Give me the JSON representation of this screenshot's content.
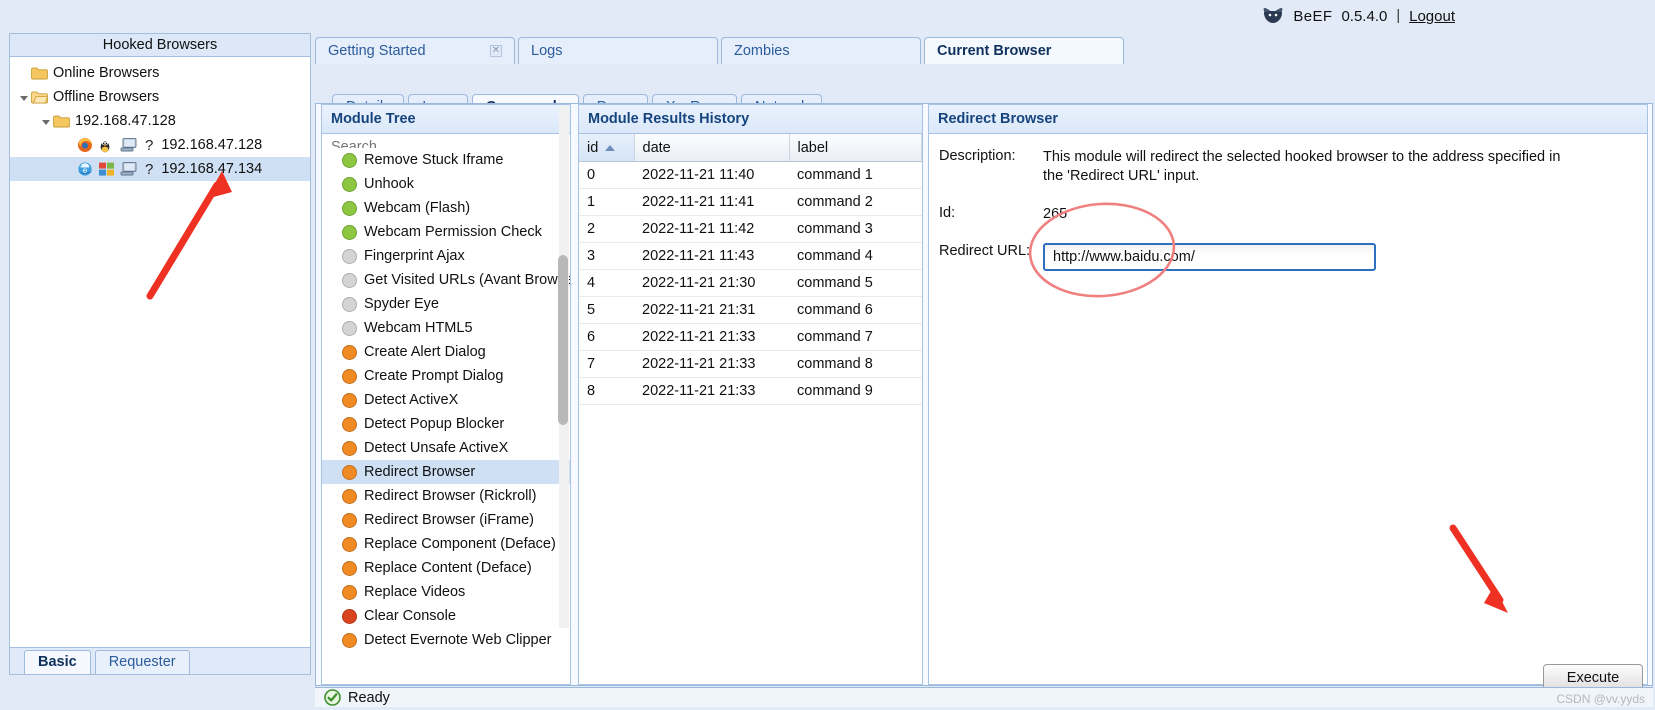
{
  "topbar": {
    "logo_icon": "beef-logo-icon",
    "app_name": "BeEF",
    "version": "0.5.4.0",
    "separator": "|",
    "logout": "Logout"
  },
  "sidebar": {
    "title": "Hooked Browsers",
    "tree": [
      {
        "label": "Online Browsers",
        "level": 1,
        "icon": "folder-icon",
        "expander": "none",
        "selected": false
      },
      {
        "label": "Offline Browsers",
        "level": 1,
        "icon": "folder-open-icon",
        "expander": "open",
        "selected": false
      },
      {
        "label": "192.168.47.128",
        "level": 2,
        "icon": "folder-icon",
        "expander": "open",
        "selected": false
      },
      {
        "label": "192.168.47.128",
        "level": 3,
        "icon": "browser-firefox-icon,os-linux-icon,monitor-icon,question-icon",
        "expander": "none",
        "selected": false
      },
      {
        "label": "192.168.47.134",
        "level": 3,
        "icon": "browser-ie-icon,os-windows-icon,monitor-icon,question-icon",
        "expander": "none",
        "selected": true
      }
    ],
    "tabs": [
      {
        "label": "Basic",
        "active": true
      },
      {
        "label": "Requester",
        "active": false
      }
    ]
  },
  "main_tabs": [
    {
      "label": "Getting Started",
      "active": false,
      "closable": true,
      "close_icon": "close-icon"
    },
    {
      "label": "Logs",
      "active": false,
      "closable": false
    },
    {
      "label": "Zombies",
      "active": false,
      "closable": false
    },
    {
      "label": "Current Browser",
      "active": true,
      "closable": false
    }
  ],
  "sub_tabs": [
    {
      "label": "Details",
      "active": false
    },
    {
      "label": "Logs",
      "active": false
    },
    {
      "label": "Commands",
      "active": true
    },
    {
      "label": "Proxy",
      "active": false
    },
    {
      "label": "XssRays",
      "active": false
    },
    {
      "label": "Network",
      "active": false
    }
  ],
  "module_tree": {
    "title": "Module Tree",
    "search_placeholder": "Search",
    "search_value": "",
    "scroll_position_pct": 42,
    "modules": [
      {
        "label": "Remove Stuck Iframe",
        "status": "green",
        "selected": false,
        "clipped": true
      },
      {
        "label": "Unhook",
        "status": "green",
        "selected": false
      },
      {
        "label": "Webcam (Flash)",
        "status": "green",
        "selected": false
      },
      {
        "label": "Webcam Permission Check",
        "status": "green",
        "selected": false
      },
      {
        "label": "Fingerprint Ajax",
        "status": "gray",
        "selected": false
      },
      {
        "label": "Get Visited URLs (Avant Browser)",
        "status": "gray",
        "selected": false
      },
      {
        "label": "Spyder Eye",
        "status": "gray",
        "selected": false
      },
      {
        "label": "Webcam HTML5",
        "status": "gray",
        "selected": false
      },
      {
        "label": "Create Alert Dialog",
        "status": "orange",
        "selected": false
      },
      {
        "label": "Create Prompt Dialog",
        "status": "orange",
        "selected": false
      },
      {
        "label": "Detect ActiveX",
        "status": "orange",
        "selected": false
      },
      {
        "label": "Detect Popup Blocker",
        "status": "orange",
        "selected": false
      },
      {
        "label": "Detect Unsafe ActiveX",
        "status": "orange",
        "selected": false
      },
      {
        "label": "Redirect Browser",
        "status": "orange",
        "selected": true
      },
      {
        "label": "Redirect Browser (Rickroll)",
        "status": "orange",
        "selected": false
      },
      {
        "label": "Redirect Browser (iFrame)",
        "status": "orange",
        "selected": false
      },
      {
        "label": "Replace Component (Deface)",
        "status": "orange",
        "selected": false
      },
      {
        "label": "Replace Content (Deface)",
        "status": "orange",
        "selected": false
      },
      {
        "label": "Replace Videos",
        "status": "orange",
        "selected": false
      },
      {
        "label": "Clear Console",
        "status": "red",
        "selected": false
      },
      {
        "label": "Detect Evernote Web Clipper",
        "status": "orange",
        "selected": false,
        "clipped": true
      }
    ],
    "status_colors": {
      "green": "#8dc641",
      "gray": "#d4d4d4",
      "orange": "#f08a24",
      "red": "#d9441f"
    }
  },
  "results": {
    "title": "Module Results History",
    "columns": [
      "id",
      "date",
      "label"
    ],
    "sort_column": "id",
    "sort_direction": "asc",
    "rows": [
      {
        "id": "0",
        "date": "2022-11-21 11:40",
        "label": "command 1"
      },
      {
        "id": "1",
        "date": "2022-11-21 11:41",
        "label": "command 2"
      },
      {
        "id": "2",
        "date": "2022-11-21 11:42",
        "label": "command 3"
      },
      {
        "id": "3",
        "date": "2022-11-21 11:43",
        "label": "command 4"
      },
      {
        "id": "4",
        "date": "2022-11-21 21:30",
        "label": "command 5"
      },
      {
        "id": "5",
        "date": "2022-11-21 21:31",
        "label": "command 6"
      },
      {
        "id": "6",
        "date": "2022-11-21 21:33",
        "label": "command 7"
      },
      {
        "id": "7",
        "date": "2022-11-21 21:33",
        "label": "command 8"
      },
      {
        "id": "8",
        "date": "2022-11-21 21:33",
        "label": "command 9"
      }
    ]
  },
  "detail": {
    "title": "Redirect Browser",
    "description_label": "Description:",
    "description_value": "This module will redirect the selected hooked browser to the address specified in the 'Redirect URL' input.",
    "id_label": "Id:",
    "id_value": "265",
    "url_label": "Redirect URL:",
    "url_value": "http://www.baidu.com/",
    "execute_label": "Execute"
  },
  "status_bar": {
    "icon": "check-circle-icon",
    "text": "Ready"
  },
  "watermark": "CSDN @vv.yyds",
  "annotations": {
    "arrow_color": "#ef3124",
    "circle_color": "#f08080",
    "arrow_sidebar": "arrow-pointing-to-192-168-47-134",
    "arrow_execute": "arrow-pointing-to-execute-button",
    "circle_url": "circle-around-redirect-url"
  }
}
